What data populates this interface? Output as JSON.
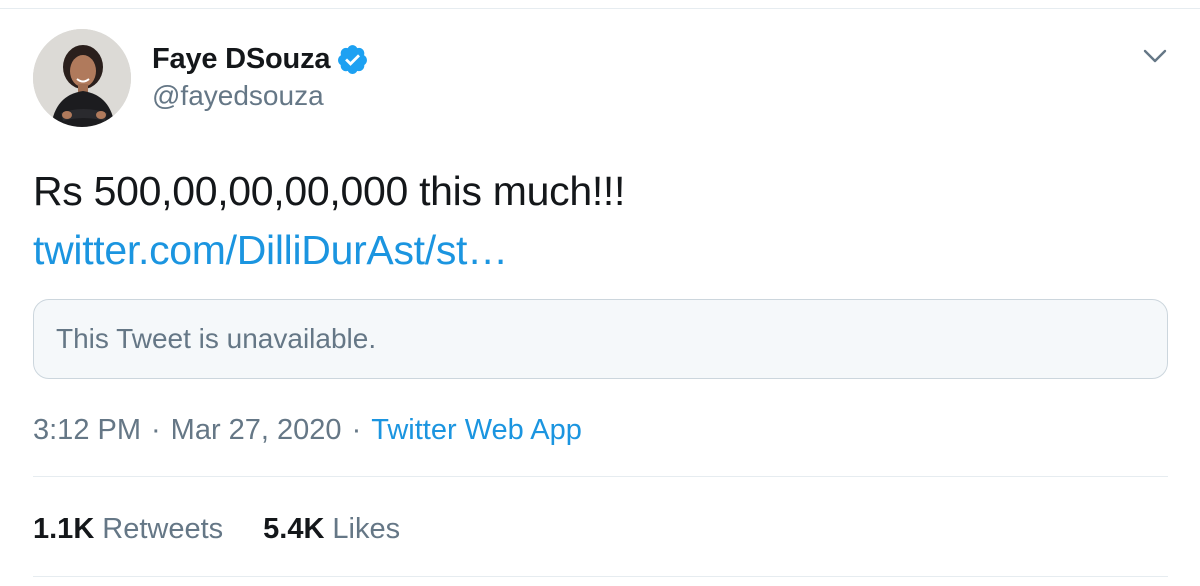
{
  "author": {
    "display_name": "Faye DSouza",
    "handle": "@fayedsouza",
    "verified": true
  },
  "tweet": {
    "text": "Rs 500,00,00,00,000 this much!!!",
    "link_text": "twitter.com/DilliDurAst/st…",
    "quoted_tweet_text": "This Tweet is unavailable."
  },
  "meta": {
    "time": "3:12 PM",
    "separator_1": "·",
    "date": "Mar 27, 2020",
    "separator_2": "·",
    "source": "Twitter Web App"
  },
  "stats": {
    "retweets_count": "1.1K",
    "retweets_label": "Retweets",
    "likes_count": "5.4K",
    "likes_label": "Likes"
  },
  "icons": {
    "verified": "verified-badge-icon",
    "menu": "chevron-down-icon"
  },
  "colors": {
    "link": "#1b95e0",
    "secondary_text": "#657786",
    "primary_text": "#14171a",
    "verified": "#1da1f2"
  }
}
